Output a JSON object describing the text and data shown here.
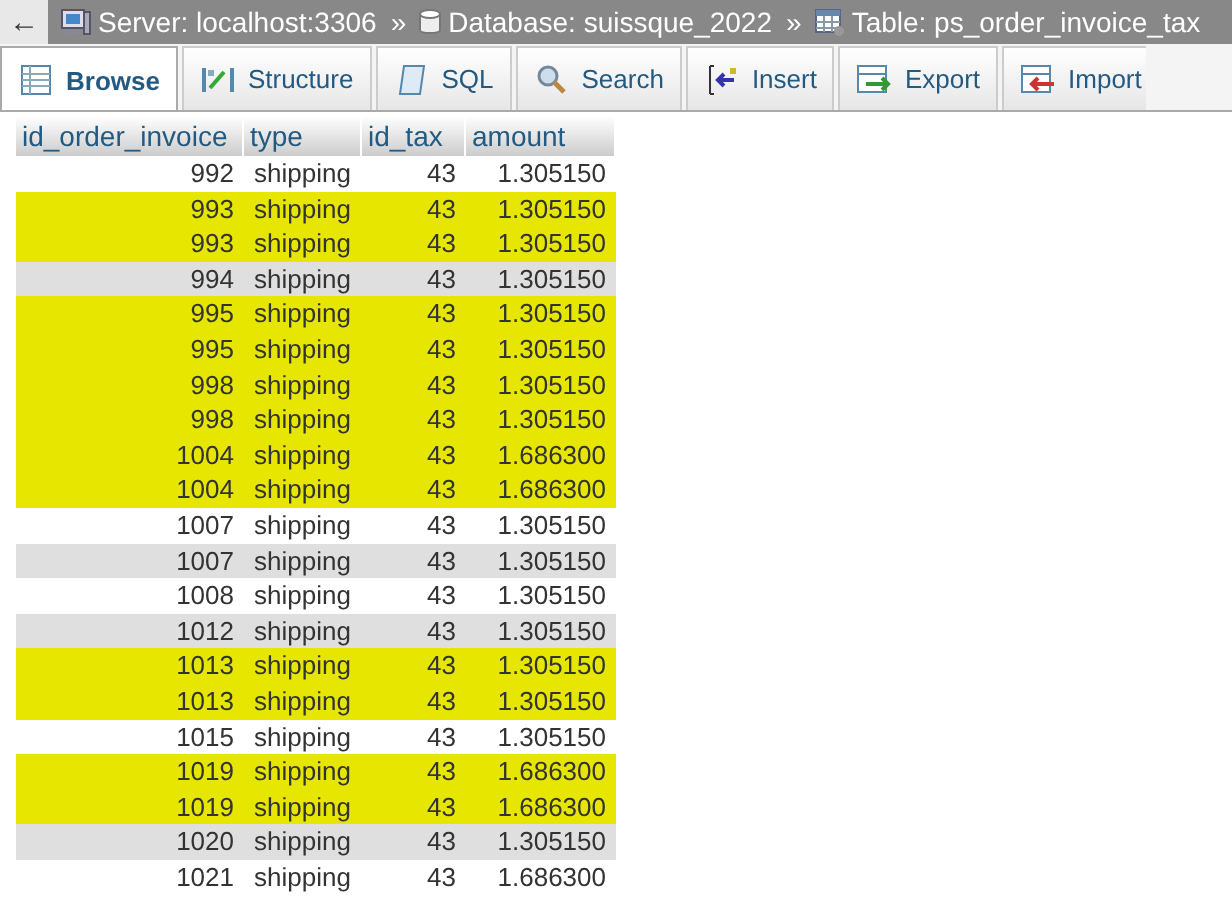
{
  "top_bar": {
    "back": "←",
    "crumbs": [
      {
        "kind": "server",
        "label": "Server: localhost:3306",
        "separator": "»"
      },
      {
        "kind": "database",
        "label": "Database: suissque_2022",
        "separator": "»"
      },
      {
        "kind": "table",
        "label": "Table: ps_order_invoice_tax"
      }
    ]
  },
  "tabs": [
    {
      "label": "Browse",
      "selected": true
    },
    {
      "label": "Structure",
      "selected": false
    },
    {
      "label": "SQL",
      "selected": false
    },
    {
      "label": "Search",
      "selected": false
    },
    {
      "label": "Insert",
      "selected": false
    },
    {
      "label": "Export",
      "selected": false
    },
    {
      "label": "Import",
      "selected": false
    }
  ],
  "table": {
    "columns": [
      "id_order_invoice",
      "type",
      "id_tax",
      "amount"
    ],
    "rows": [
      {
        "cells": [
          "992",
          "shipping",
          "43",
          "1.305150"
        ],
        "highlighted": false
      },
      {
        "cells": [
          "993",
          "shipping",
          "43",
          "1.305150"
        ],
        "highlighted": true
      },
      {
        "cells": [
          "993",
          "shipping",
          "43",
          "1.305150"
        ],
        "highlighted": true
      },
      {
        "cells": [
          "994",
          "shipping",
          "43",
          "1.305150"
        ],
        "highlighted": false
      },
      {
        "cells": [
          "995",
          "shipping",
          "43",
          "1.305150"
        ],
        "highlighted": true
      },
      {
        "cells": [
          "995",
          "shipping",
          "43",
          "1.305150"
        ],
        "highlighted": true
      },
      {
        "cells": [
          "998",
          "shipping",
          "43",
          "1.305150"
        ],
        "highlighted": true
      },
      {
        "cells": [
          "998",
          "shipping",
          "43",
          "1.305150"
        ],
        "highlighted": true
      },
      {
        "cells": [
          "1004",
          "shipping",
          "43",
          "1.686300"
        ],
        "highlighted": true
      },
      {
        "cells": [
          "1004",
          "shipping",
          "43",
          "1.686300"
        ],
        "highlighted": true
      },
      {
        "cells": [
          "1007",
          "shipping",
          "43",
          "1.305150"
        ],
        "highlighted": false
      },
      {
        "cells": [
          "1007",
          "shipping",
          "43",
          "1.305150"
        ],
        "highlighted": false
      },
      {
        "cells": [
          "1008",
          "shipping",
          "43",
          "1.305150"
        ],
        "highlighted": false
      },
      {
        "cells": [
          "1012",
          "shipping",
          "43",
          "1.305150"
        ],
        "highlighted": false
      },
      {
        "cells": [
          "1013",
          "shipping",
          "43",
          "1.305150"
        ],
        "highlighted": true
      },
      {
        "cells": [
          "1013",
          "shipping",
          "43",
          "1.305150"
        ],
        "highlighted": true
      },
      {
        "cells": [
          "1015",
          "shipping",
          "43",
          "1.305150"
        ],
        "highlighted": false
      },
      {
        "cells": [
          "1019",
          "shipping",
          "43",
          "1.686300"
        ],
        "highlighted": true
      },
      {
        "cells": [
          "1019",
          "shipping",
          "43",
          "1.686300"
        ],
        "highlighted": true
      },
      {
        "cells": [
          "1020",
          "shipping",
          "43",
          "1.305150"
        ],
        "highlighted": false
      },
      {
        "cells": [
          "1021",
          "shipping",
          "43",
          "1.686300"
        ],
        "highlighted": false
      }
    ]
  }
}
